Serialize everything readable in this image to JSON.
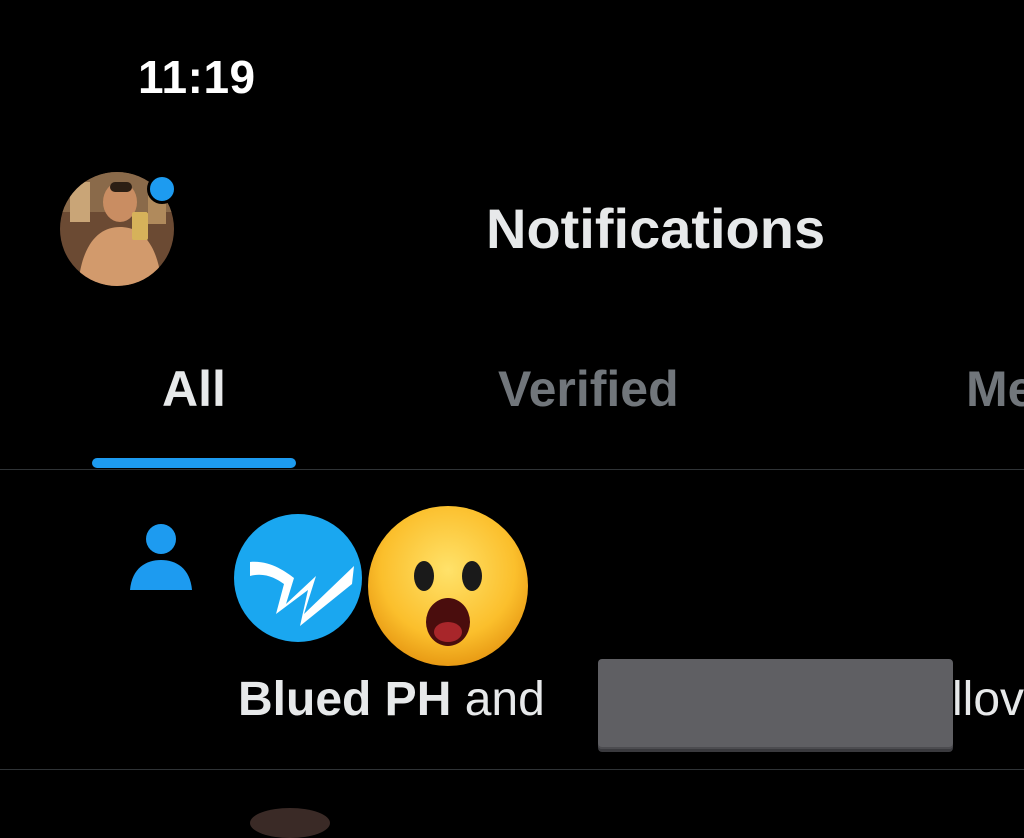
{
  "status_bar": {
    "time": "11:19"
  },
  "header": {
    "title": "Notifications",
    "avatar_icon": "profile-avatar"
  },
  "tabs": [
    {
      "label": "All",
      "active": true
    },
    {
      "label": "Verified",
      "active": false
    },
    {
      "label": "Me",
      "active": false
    }
  ],
  "notification": {
    "icon": "person-icon",
    "actor": "Blued PH",
    "conjunction": "and",
    "trailing_text": "llov"
  },
  "colors": {
    "accent": "#1d9bf0",
    "background": "#000000",
    "muted": "#71767b"
  }
}
